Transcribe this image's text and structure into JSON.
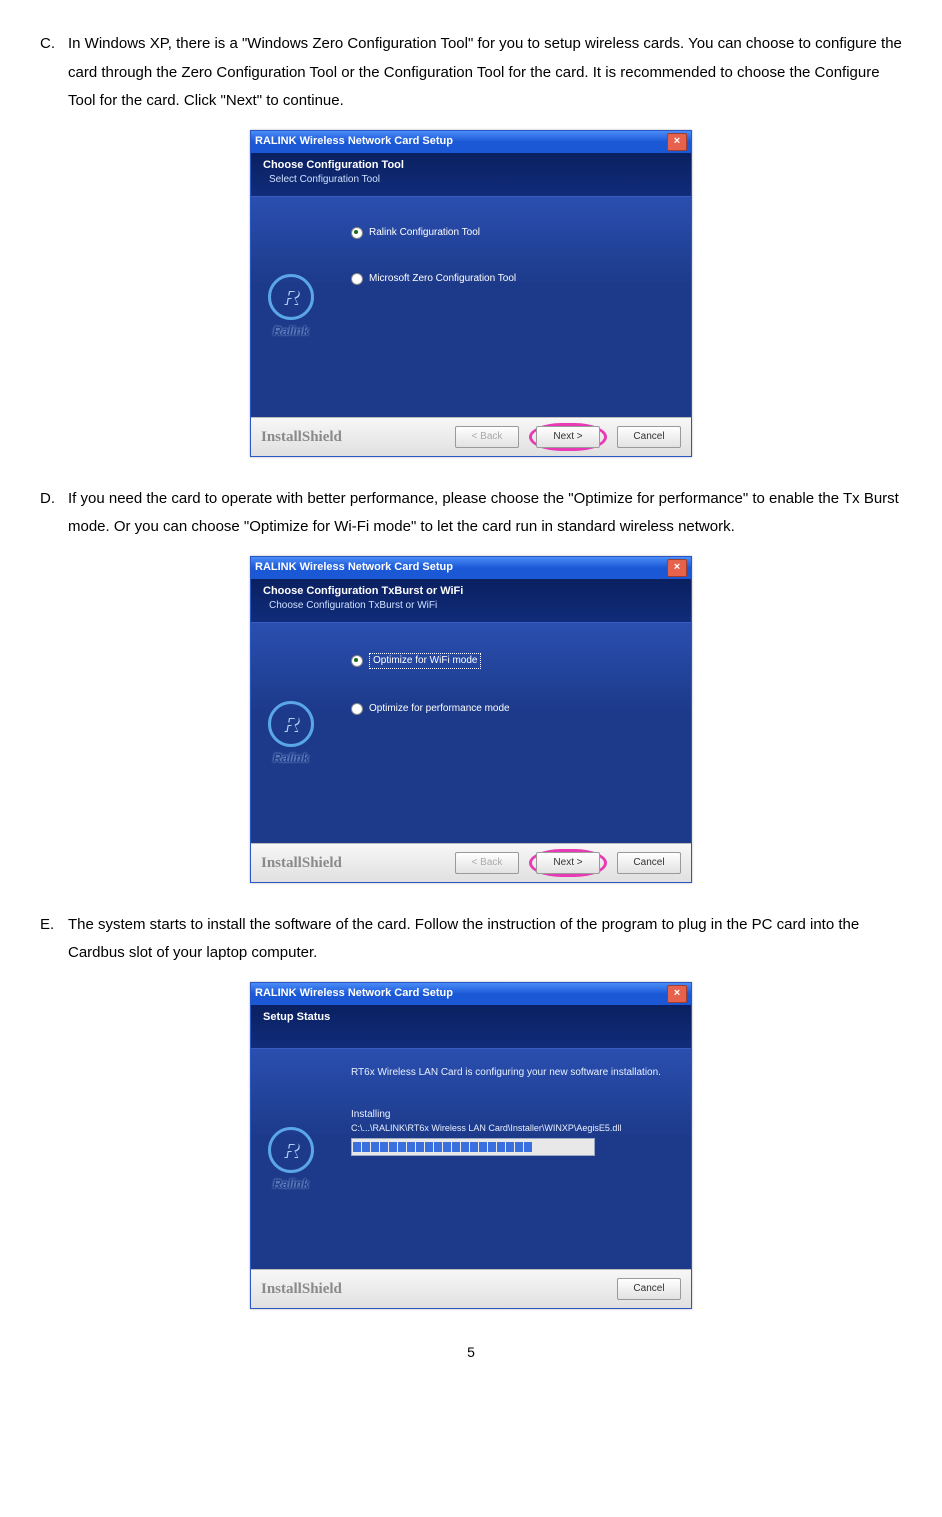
{
  "items": {
    "c": {
      "letter": "C.",
      "text": "In Windows XP, there is a \"Windows Zero Configuration Tool\" for you to setup wireless cards. You can choose to configure the card through the Zero Configuration Tool or the Configuration Tool for the card. It is recommended to choose the Configure Tool for the card. Click \"Next\" to continue."
    },
    "d": {
      "letter": "D.",
      "text": "If you need the card to operate with better performance, please choose the \"Optimize for performance\" to enable the Tx Burst mode. Or you can choose \"Optimize for Wi-Fi mode\" to let the card run in standard wireless network."
    },
    "e": {
      "letter": "E.",
      "text": "The system starts to install the software of the card. Follow the instruction of the program to plug in the PC card into the Cardbus slot of your laptop computer."
    }
  },
  "wincommon": {
    "title": "RALINK Wireless Network Card Setup",
    "brand": "Ralink",
    "installshield": "InstallShield"
  },
  "win1": {
    "head_title": "Choose Configuration Tool",
    "head_sub": "Select Configuration Tool",
    "opt1": "Ralink Configuration Tool",
    "opt2": "Microsoft Zero Configuration Tool",
    "back": "< Back",
    "next": "Next >",
    "cancel": "Cancel"
  },
  "win2": {
    "head_title": "Choose Configuration TxBurst or WiFi",
    "head_sub": "Choose Configuration TxBurst or WiFi",
    "opt1": "Optimize for WiFi mode",
    "opt2": "Optimize for performance mode",
    "back": "< Back",
    "next": "Next >",
    "cancel": "Cancel"
  },
  "win3": {
    "head_title": "Setup Status",
    "head_sub": "",
    "line1": "RT6x Wireless LAN Card is configuring your new software installation.",
    "installing": "Installing",
    "path": "C:\\...\\RALINK\\RT6x Wireless LAN Card\\Installer\\WINXP\\AegisE5.dll",
    "cancel": "Cancel"
  },
  "page": "5"
}
